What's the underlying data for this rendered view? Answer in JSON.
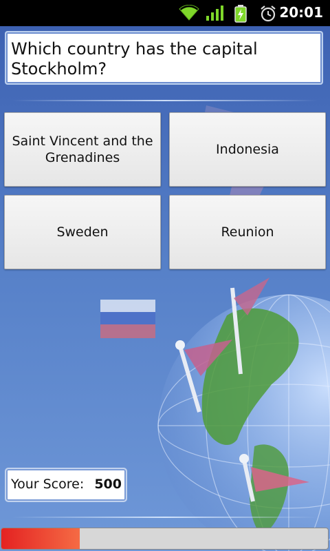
{
  "status_bar": {
    "time": "20:01",
    "icons": [
      "wifi-icon",
      "signal-icon",
      "battery-charging-icon",
      "alarm-icon"
    ]
  },
  "question": {
    "text": "Which country has the capital Stockholm?"
  },
  "answers": [
    {
      "label": "Saint Vincent and the Grenadines"
    },
    {
      "label": "Indonesia"
    },
    {
      "label": "Sweden"
    },
    {
      "label": "Reunion"
    }
  ],
  "score": {
    "label": "Your Score:",
    "value": "500"
  },
  "progress": {
    "fraction": 0.24
  },
  "colors": {
    "background": "#5680c8",
    "progress_fill": "#e42222"
  }
}
